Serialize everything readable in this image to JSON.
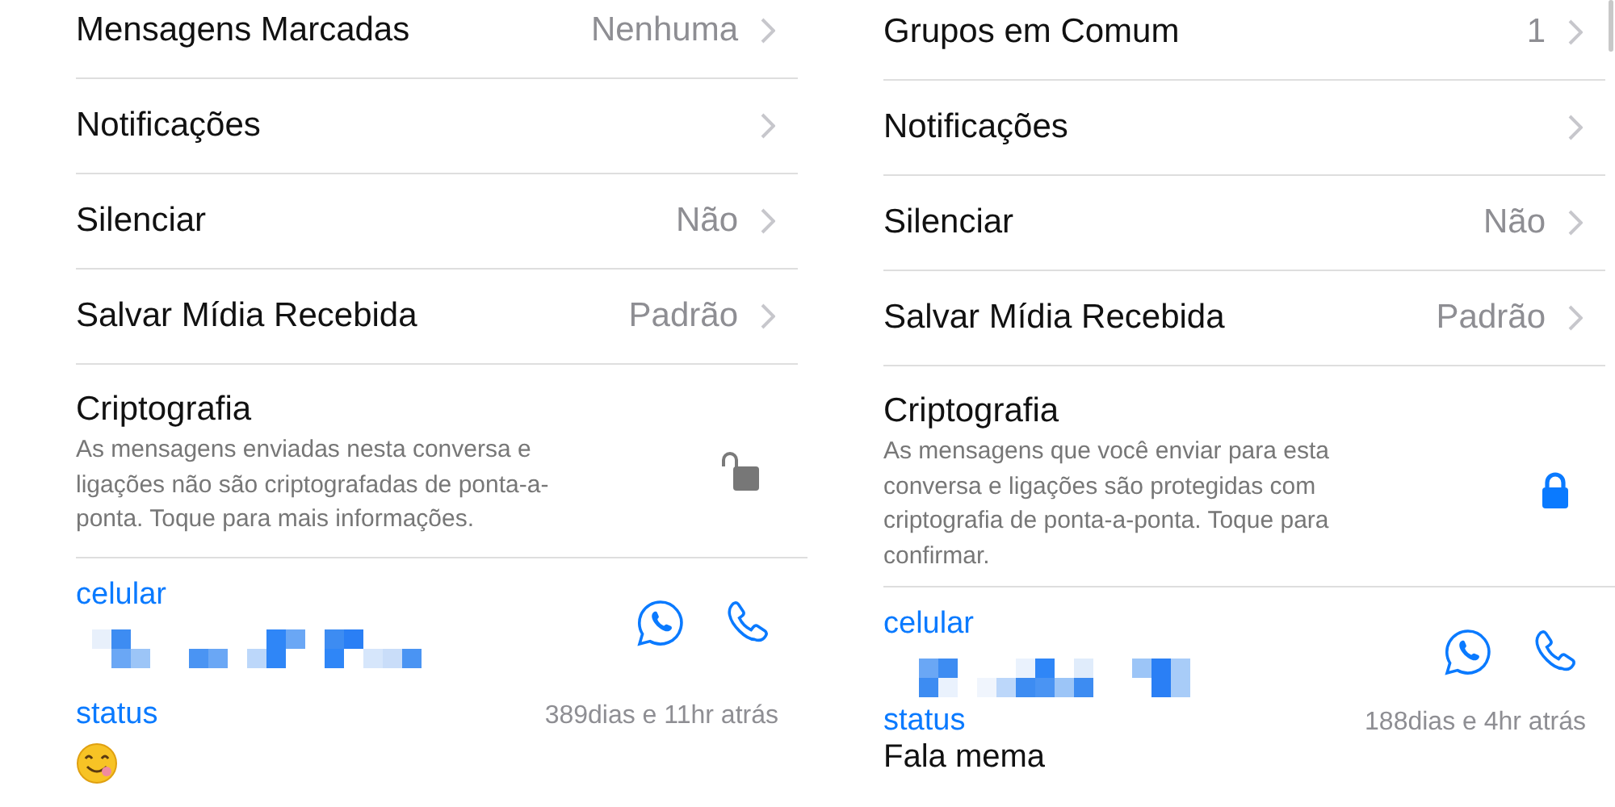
{
  "panels": [
    {
      "rows": [
        {
          "label": "Mensagens Marcadas",
          "value": "Nenhuma"
        },
        {
          "label": "Notificações"
        },
        {
          "label": "Silenciar",
          "value": "Não"
        },
        {
          "label": "Salvar Mídia Recebida",
          "value": "Padrão"
        }
      ],
      "encryption": {
        "title": "Criptografia",
        "description": "As mensagens enviadas nesta conversa e ligações não são criptografadas de ponta-a-ponta. Toque para mais informações.",
        "locked": false
      },
      "phone": {
        "label": "celular"
      },
      "status": {
        "label": "status",
        "time": "389dias e 11hr atrás",
        "kind": "emoji"
      }
    },
    {
      "rows": [
        {
          "label": "Grupos em Comum",
          "value": "1"
        },
        {
          "label": "Notificações"
        },
        {
          "label": "Silenciar",
          "value": "Não"
        },
        {
          "label": "Salvar Mídia Recebida",
          "value": "Padrão"
        }
      ],
      "encryption": {
        "title": "Criptografia",
        "description": "As mensagens que você enviar para esta conversa e ligações são protegidas com criptografia de ponta-a-ponta. Toque para confirmar.",
        "locked": true
      },
      "phone": {
        "label": "celular"
      },
      "status": {
        "label": "status",
        "time": "188dias e 4hr atrás",
        "kind": "text",
        "text": "Fala mema"
      }
    }
  ]
}
